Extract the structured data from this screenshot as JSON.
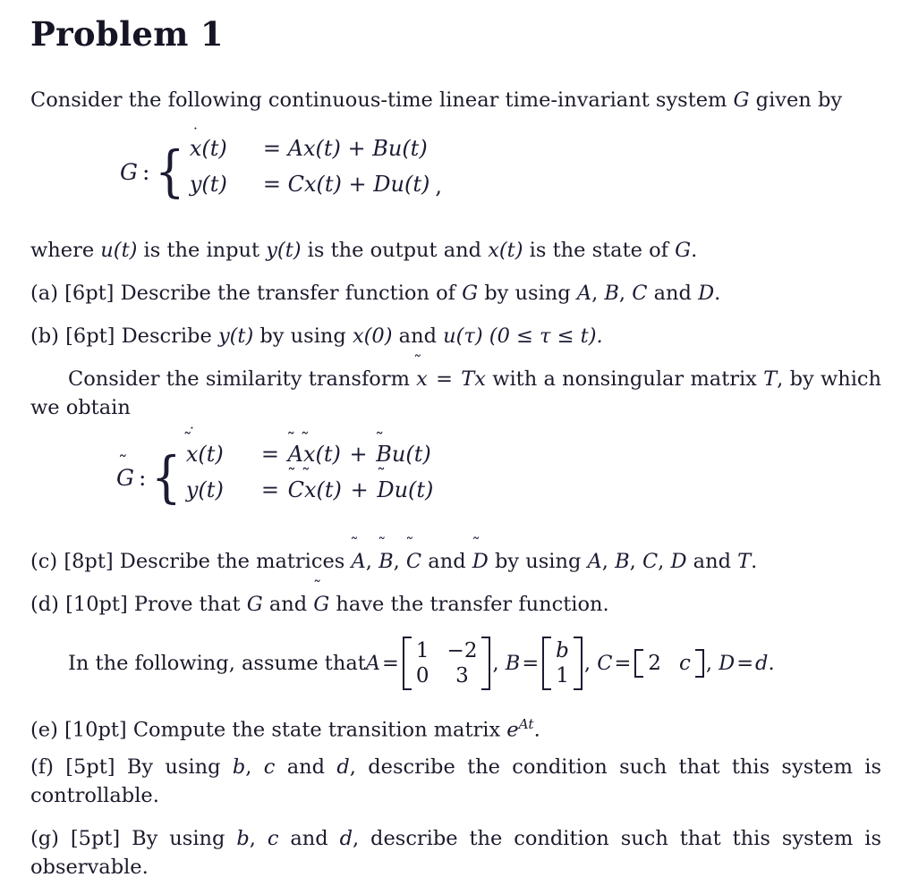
{
  "document": {
    "title": "Problem 1",
    "text_color": "#1b1b2c",
    "background_color": "#ffffff"
  },
  "intro": {
    "before_G": "Consider the following continuous-time linear time-invariant system ",
    "symbol_G": "G",
    "after_G": " given by"
  },
  "equation_G": {
    "lhs": "G",
    "colon": ":",
    "rows": [
      {
        "left_dot": "̇",
        "left": "x(t)",
        "right": "= Ax(t) + Bu(t)"
      },
      {
        "left": "y(t)",
        "right": "= Cx(t) + Du(t)"
      }
    ],
    "trailing": ","
  },
  "where_line": {
    "t1": "where ",
    "m1": "u(t)",
    "t2": " is the input ",
    "m2": "y(t)",
    "t3": " is the output and ",
    "m3": "x(t)",
    "t4": " is the state of ",
    "m4": "G",
    "t5": "."
  },
  "items": {
    "a": {
      "label": "(a)",
      "points": "[6pt]",
      "t1": " Describe the transfer function of ",
      "m1": "G",
      "t2": " by using ",
      "m2": "A",
      "t3": ", ",
      "m3": "B",
      "t4": ", ",
      "m4": "C",
      "t5": " and ",
      "m5": "D",
      "t6": "."
    },
    "b": {
      "label": "(b)",
      "points": "[6pt]",
      "t1": " Describe ",
      "m1": "y(t)",
      "t2": " by using ",
      "m2": "x(0)",
      "t3": " and ",
      "m3": "u(τ)",
      "t4": " (0 ≤ τ ≤ t)."
    },
    "c": {
      "label": "(c)",
      "points": "[8pt]",
      "t1": " Describe the matrices ",
      "m1": "A",
      "t2": ", ",
      "m2": "B",
      "t3": ", ",
      "m3": "C",
      "t4": " and ",
      "m4": "D",
      "t5": " by using ",
      "m5": "A",
      "t6": ", ",
      "m6": "B",
      "t7": ", ",
      "m7": "C",
      "t8": ", ",
      "m8": "D",
      "t9": " and ",
      "m9": "T",
      "t10": "."
    },
    "d": {
      "label": "(d)",
      "points": "[10pt]",
      "t1": " Prove that ",
      "m1": "G",
      "t2": " and ",
      "m2": "G",
      "t3": " have the transfer function."
    },
    "e": {
      "label": "(e)",
      "points": "[10pt]",
      "t1": " Compute the state transition matrix ",
      "m1": "e",
      "m1_sup": "At",
      "t2": "."
    },
    "f": {
      "label": "(f)",
      "points": "[5pt]",
      "t1": " By using ",
      "m1": "b",
      "t2": ", ",
      "m2": "c",
      "t3": " and ",
      "m3": "d",
      "t4": ", describe the condition such that this system is controllable."
    },
    "g": {
      "label": "(g)",
      "points": "[5pt]",
      "t1": " By using ",
      "m1": "b",
      "t2": ", ",
      "m2": "c",
      "t3": " and ",
      "m3": "d",
      "t4": ", describe the condition such that this system is observable."
    }
  },
  "similarity": {
    "t1": "Consider the similarity transform ",
    "m1": "x",
    "t2": " = ",
    "m2": "Tx",
    "t3": " with a nonsingular matrix ",
    "m3": "T",
    "t4": ", by which we obtain"
  },
  "equation_Gtilde": {
    "lhs": "G",
    "colon": ":",
    "rows": [
      {
        "left_dot": "̇",
        "left": "x(t)",
        "right_A": "A",
        "right_x": "x(t)",
        "right_plus": "+",
        "right_B": "B",
        "right_u": "u(t)"
      },
      {
        "left": "y(t)",
        "right_C": "C",
        "right_x": "x(t)",
        "right_plus": "+",
        "right_D": "D",
        "right_u": "u(t)"
      }
    ]
  },
  "assume": {
    "lead": "In the following, assume that ",
    "A_label": "A",
    "eq": "=",
    "matrix_A": {
      "rows": [
        [
          "1",
          "−2"
        ],
        [
          "0",
          "3"
        ]
      ]
    },
    "comma1": ",",
    "B_label": "B",
    "matrix_B": {
      "rows": [
        [
          "b"
        ],
        [
          "1"
        ]
      ]
    },
    "comma2": ",",
    "C_label": "C",
    "matrix_C": {
      "rows": [
        [
          "2",
          "c"
        ]
      ]
    },
    "comma3": ",",
    "D_label": "D",
    "D_value": "d",
    "period": "."
  },
  "tilde_mark": "̃",
  "dot_mark": "˙"
}
